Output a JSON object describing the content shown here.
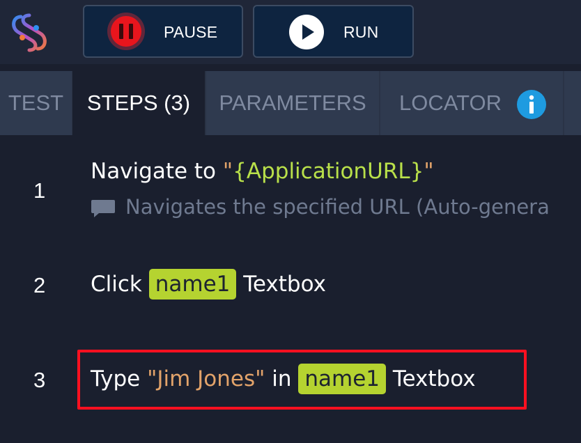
{
  "toolbar": {
    "logo_icon": "app-logo-icon",
    "pause_label": "PAUSE",
    "pause_icon": "pause-icon",
    "run_label": "RUN",
    "run_icon": "play-icon",
    "pause_color": "#e8151d"
  },
  "tabs": [
    {
      "label": "TEST",
      "active": false
    },
    {
      "label": "STEPS (3)",
      "active": true
    },
    {
      "label": "PARAMETERS",
      "active": false
    },
    {
      "label": "LOCATOR",
      "active": false,
      "icon": "info-icon"
    }
  ],
  "steps": [
    {
      "number": "1",
      "action": "Navigate to",
      "open_quote": "\"",
      "value": "{ApplicationURL}",
      "close_quote": "\"",
      "comment": "Navigates the specified URL (Auto-genera",
      "comment_icon": "comment-icon"
    },
    {
      "number": "2",
      "action": "Click",
      "locator": "name1",
      "suffix": "Textbox"
    },
    {
      "number": "3",
      "action": "Type",
      "typed_text": "\"Jim Jones\"",
      "preposition": "in",
      "locator": "name1",
      "suffix": "Textbox",
      "highlighted": true
    }
  ],
  "colors": {
    "background": "#1a1f2e",
    "accent_locator": "#b5d330",
    "parameter": "#b9e04a",
    "string": "#e2a36a",
    "highlight": "#ff1020",
    "info": "#1e9be0"
  }
}
